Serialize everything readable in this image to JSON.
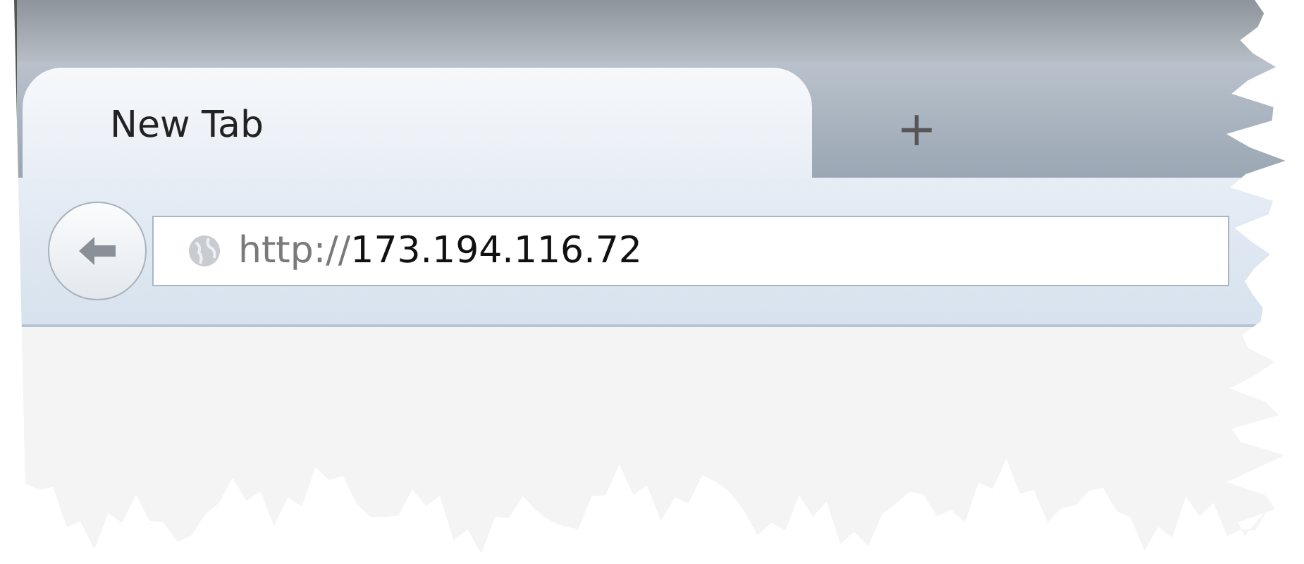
{
  "tabs": [
    {
      "label": "New Tab",
      "selected": true
    }
  ],
  "new_tab_button": "+",
  "address_bar": {
    "scheme": "http://",
    "host": "173.194.116.72"
  }
}
